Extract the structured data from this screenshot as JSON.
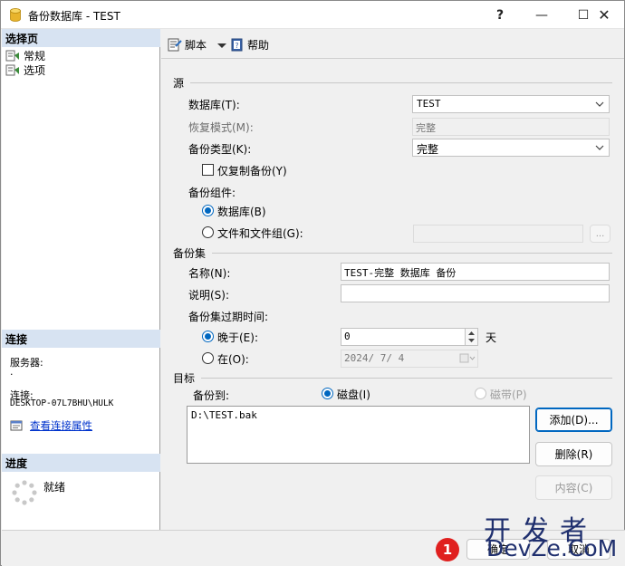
{
  "window": {
    "title": "备份数据库 - TEST",
    "help_glyph": "?",
    "minimize_glyph": "—",
    "maximize_glyph": "☐",
    "close_glyph": "✕"
  },
  "left_pane": {
    "select_page_header": "选择页",
    "pages": [
      {
        "label": "常规"
      },
      {
        "label": "选项"
      }
    ],
    "connection_header": "连接",
    "server_label": "服务器:",
    "server_value": ".",
    "connection_label": "连接:",
    "connection_value": "DESKTOP-07L7BHU\\HULK",
    "view_connection_link": "查看连接属性",
    "progress_header": "进度",
    "progress_status": "就绪"
  },
  "toolbar": {
    "script_label": "脚本",
    "help_label": "帮助"
  },
  "source": {
    "section_title": "源",
    "database_label": "数据库(T):",
    "database_value": "TEST",
    "recovery_model_label": "恢复模式(M):",
    "recovery_model_value": "完整",
    "backup_type_label": "备份类型(K):",
    "backup_type_value": "完整",
    "copy_only_label": "仅复制备份(Y)",
    "copy_only_checked": false,
    "component_label": "备份组件:",
    "component_database_label": "数据库(B)",
    "component_files_label": "文件和文件组(G):",
    "files_browse_label": "..."
  },
  "backup_set": {
    "section_title": "备份集",
    "name_label": "名称(N):",
    "name_value": "TEST-完整 数据库 备份",
    "description_label": "说明(S):",
    "description_value": "",
    "expire_label": "备份集过期时间:",
    "after_label": "晚于(E):",
    "after_value": "0",
    "days_label": "天",
    "on_label": "在(O):",
    "on_value": "2024/ 7/ 4"
  },
  "destination": {
    "section_title": "目标",
    "backup_to_label": "备份到:",
    "disk_label": "磁盘(I)",
    "tape_label": "磁带(P)",
    "paths": [
      "D:\\TEST.bak"
    ],
    "add_button": "添加(D)...",
    "remove_button": "删除(R)",
    "contents_button": "内容(C)"
  },
  "footer": {
    "ok_button": "确定",
    "cancel_button": "取消",
    "badge": "1"
  },
  "watermark": {
    "cn": "开发者",
    "en": "DevZe.CoM"
  },
  "colors": {
    "accent": "#0067c0",
    "pane_header": "#d7e3f2",
    "badge": "#e0201f",
    "watermark": "#1f2f6e"
  }
}
